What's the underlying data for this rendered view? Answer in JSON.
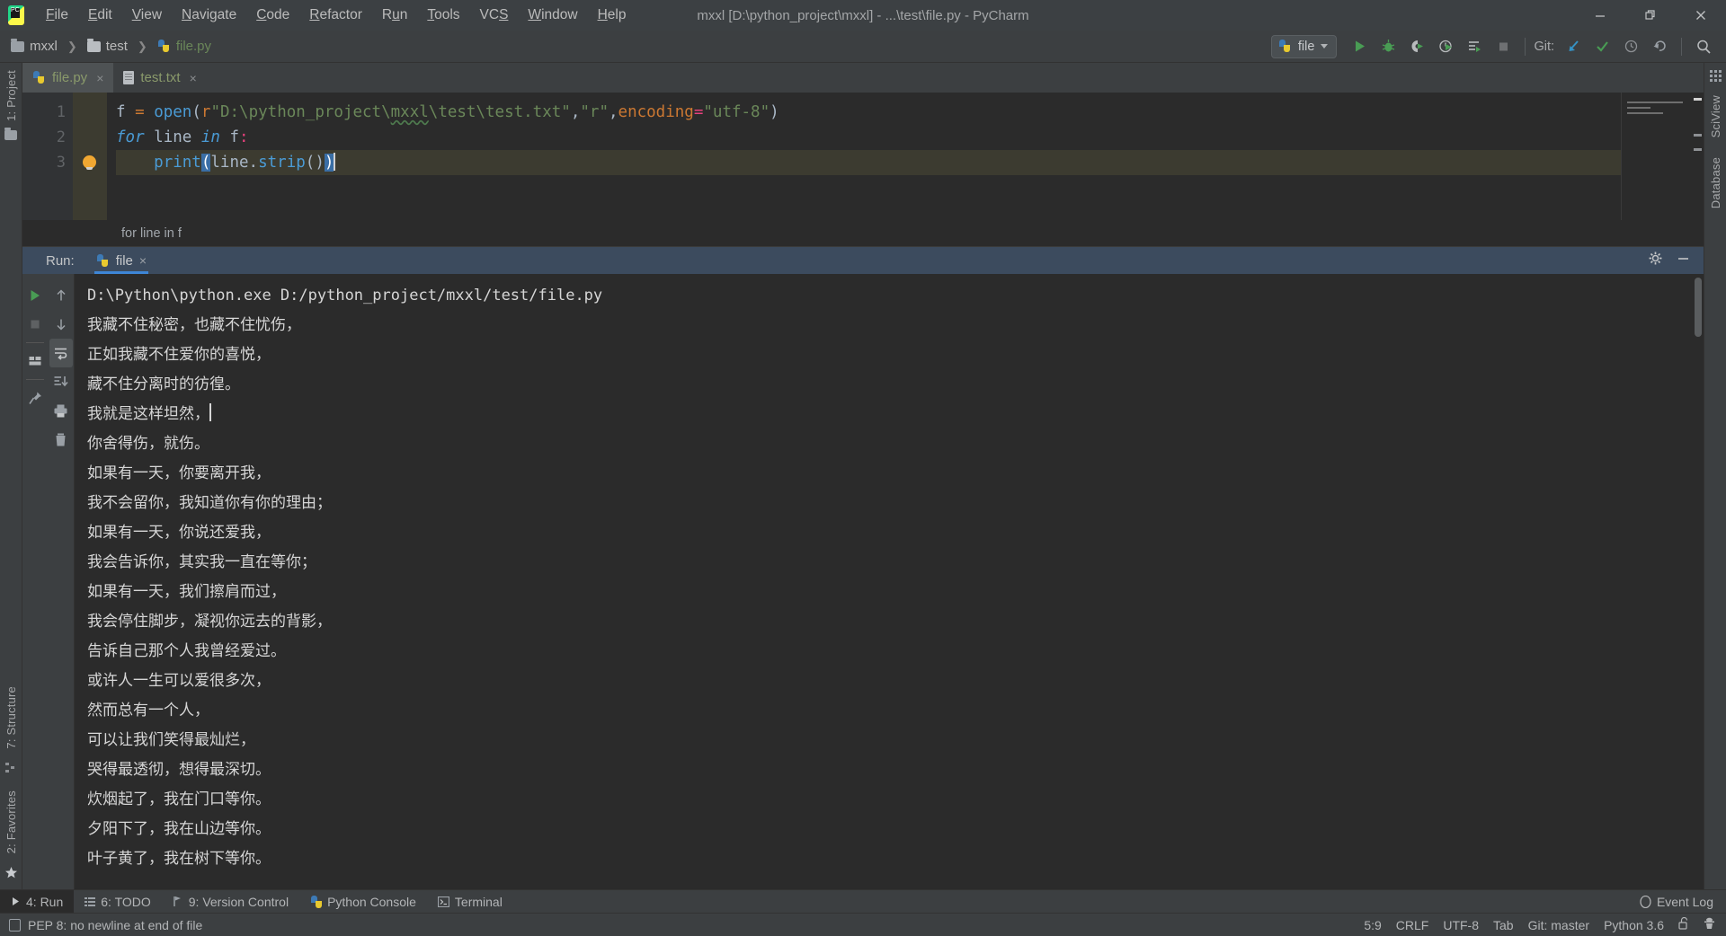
{
  "window": {
    "title": "mxxl [D:\\python_project\\mxxl] - ...\\test\\file.py - PyCharm",
    "app_icon": "pycharm-logo",
    "minimize_label": "Minimize",
    "restore_label": "Restore",
    "close_label": "Close"
  },
  "menubar": {
    "items": [
      {
        "label": "File",
        "mnemonic": "F"
      },
      {
        "label": "Edit",
        "mnemonic": "E"
      },
      {
        "label": "View",
        "mnemonic": "V"
      },
      {
        "label": "Navigate",
        "mnemonic": "N"
      },
      {
        "label": "Code",
        "mnemonic": "C"
      },
      {
        "label": "Refactor",
        "mnemonic": "R"
      },
      {
        "label": "Run",
        "mnemonic": "u"
      },
      {
        "label": "Tools",
        "mnemonic": "T"
      },
      {
        "label": "VCS",
        "mnemonic": "S"
      },
      {
        "label": "Window",
        "mnemonic": "W"
      },
      {
        "label": "Help",
        "mnemonic": "H"
      }
    ]
  },
  "breadcrumb": {
    "items": [
      {
        "label": "mxxl",
        "icon": "folder-icon"
      },
      {
        "label": "test",
        "icon": "folder-icon"
      },
      {
        "label": "file.py",
        "icon": "python-file-icon"
      }
    ]
  },
  "toolbar": {
    "run_config": {
      "name": "file",
      "icon": "python-icon",
      "dropdown": "chevron-down-icon"
    },
    "buttons": [
      {
        "name": "run-button",
        "icon": "play-icon",
        "color": "#499c54"
      },
      {
        "name": "debug-button",
        "icon": "bug-icon",
        "color": "#499c54"
      },
      {
        "name": "run-coverage-button",
        "icon": "coverage-icon",
        "color": "#499c54"
      },
      {
        "name": "profile-button",
        "icon": "profiler-icon",
        "color": "#499c54"
      },
      {
        "name": "run-with-console-button",
        "icon": "list-run-icon",
        "color": "#499c54"
      },
      {
        "name": "stop-button",
        "icon": "stop-icon",
        "color": "#6e7072"
      }
    ],
    "git_label": "Git:",
    "git_buttons": [
      {
        "name": "update-project-button",
        "icon": "arrow-down-left-icon",
        "color": "#3592c4"
      },
      {
        "name": "commit-button",
        "icon": "check-icon",
        "color": "#499c54"
      },
      {
        "name": "history-button",
        "icon": "clock-icon",
        "color": "#9aa0a6"
      },
      {
        "name": "rollback-button",
        "icon": "undo-icon",
        "color": "#9aa0a6"
      }
    ],
    "search_button": {
      "name": "search-everywhere-button",
      "icon": "search-icon"
    }
  },
  "sidebar_left": {
    "project_label": "1: Project",
    "structure_label": "7: Structure",
    "favorites_label": "2: Favorites"
  },
  "sidebar_right": {
    "sciview_label": "SciView",
    "database_label": "Database"
  },
  "editor": {
    "tabs": [
      {
        "label": "file.py",
        "icon": "python-file-icon",
        "active": true,
        "close": "×"
      },
      {
        "label": "test.txt",
        "icon": "text-file-icon",
        "active": false,
        "close": "×"
      }
    ],
    "line_numbers": [
      "1",
      "2",
      "3"
    ],
    "code_lines": [
      "f = open(r\"D:\\python_project\\mxxl\\test\\test.txt\",\"r\",encoding=\"utf-8\")",
      "for line in f:",
      "    print(line.strip())"
    ],
    "intention_bulb": "lightbulb-icon",
    "breadcrumb_text": "for line in f"
  },
  "run_panel": {
    "label": "Run:",
    "tab": {
      "label": "file",
      "icon": "python-icon",
      "close": "×"
    },
    "settings_icon": "gear-icon",
    "minimize_icon": "minimize-icon",
    "tools": [
      {
        "name": "rerun-button",
        "icon": "play-icon"
      },
      {
        "name": "stop-button",
        "icon": "stop-icon"
      },
      {
        "name": "layout-button",
        "icon": "layout-icon"
      },
      {
        "name": "pin-tab-button",
        "icon": "pin-icon"
      },
      {
        "name": "up-stacktrace-button",
        "icon": "arrow-up-icon"
      },
      {
        "name": "down-stacktrace-button",
        "icon": "arrow-down-icon"
      },
      {
        "name": "soft-wrap-button",
        "icon": "wrap-icon"
      },
      {
        "name": "scroll-to-end-button",
        "icon": "scroll-end-icon"
      },
      {
        "name": "print-button",
        "icon": "printer-icon"
      },
      {
        "name": "clear-all-button",
        "icon": "trash-icon"
      }
    ],
    "console_lines": [
      "D:\\Python\\python.exe D:/python_project/mxxl/test/file.py",
      "我藏不住秘密，也藏不住忧伤，",
      "正如我藏不住爱你的喜悦，",
      "藏不住分离时的彷徨。",
      "我就是这样坦然，",
      "你舍得伤，就伤。",
      "如果有一天，你要离开我，",
      "我不会留你，我知道你有你的理由；",
      "如果有一天，你说还爱我，",
      "我会告诉你，其实我一直在等你；",
      "如果有一天，我们擦肩而过，",
      "我会停住脚步，凝视你远去的背影，",
      "告诉自己那个人我曾经爱过。",
      "或许人一生可以爱很多次，",
      "然而总有一个人，",
      "可以让我们笑得最灿烂，",
      "哭得最透彻，想得最深切。",
      "炊烟起了，我在门口等你。",
      "夕阳下了，我在山边等你。",
      "叶子黄了，我在树下等你。"
    ],
    "caret_line_index": 4
  },
  "bottom_toolbar": {
    "items": [
      {
        "label": "4: Run",
        "mnemonic": "4",
        "icon": "play-icon",
        "active": true
      },
      {
        "label": "6: TODO",
        "mnemonic": "6",
        "icon": "todo-icon",
        "active": false
      },
      {
        "label": "9: Version Control",
        "mnemonic": "9",
        "icon": "branch-icon",
        "active": false
      },
      {
        "label": "Python Console",
        "mnemonic": "",
        "icon": "python-icon",
        "active": false
      },
      {
        "label": "Terminal",
        "mnemonic": "",
        "icon": "terminal-icon",
        "active": false
      }
    ],
    "event_log": {
      "label": "Event Log",
      "icon": "event-log-icon"
    }
  },
  "status_bar": {
    "message": "PEP 8: no newline at end of file",
    "message_icon": "inspection-icon",
    "caret_position": "5:9",
    "line_separator": "CRLF",
    "encoding": "UTF-8",
    "indent": "Tab",
    "branch": "Git: master",
    "interpreter": "Python 3.6",
    "lock_icon": "unlocked-icon",
    "inspector_icon": "hector-icon"
  },
  "colors": {
    "accent_blue": "#3e86d6",
    "green": "#499c54",
    "editor_bg": "#2b2b2b",
    "chrome_bg": "#3c3f41",
    "string_green": "#6a8759",
    "keyword_orange": "#cc7832"
  }
}
